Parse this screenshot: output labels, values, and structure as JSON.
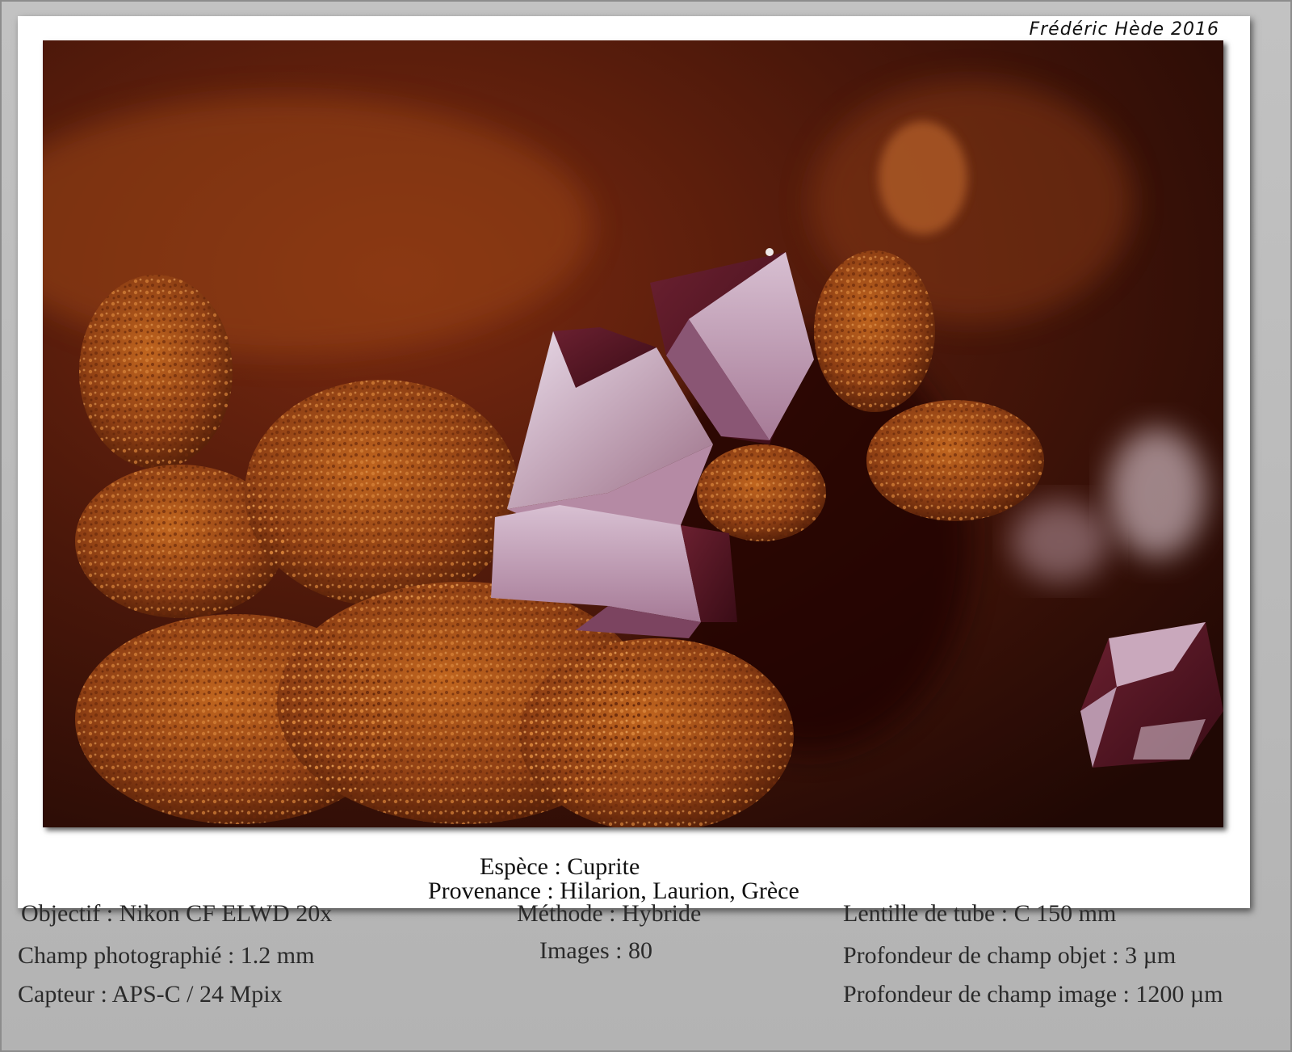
{
  "credit": "Frédéric Hède 2016",
  "photo": {
    "subject": "cuprite-crystals-micrograph",
    "colors": {
      "background": "#3a1208",
      "matrix": "#a5501a",
      "crystal": "#c8a4b8"
    }
  },
  "caption": {
    "species_label": "Espèce : Cuprite",
    "origin_label": "Provenance : Hilarion, Laurion, Grèce"
  },
  "specs": {
    "left": [
      "Objectif : Nikon CF ELWD 20x",
      "Champ photographié : 1.2 mm",
      "Capteur : APS-C / 24 Mpix"
    ],
    "center": [
      "Méthode : Hybride",
      "Images : 80"
    ],
    "right": [
      "Lentille de tube : C 150 mm",
      "Profondeur de champ objet : 3 µm",
      "Profondeur de champ image : 1200 µm"
    ]
  }
}
